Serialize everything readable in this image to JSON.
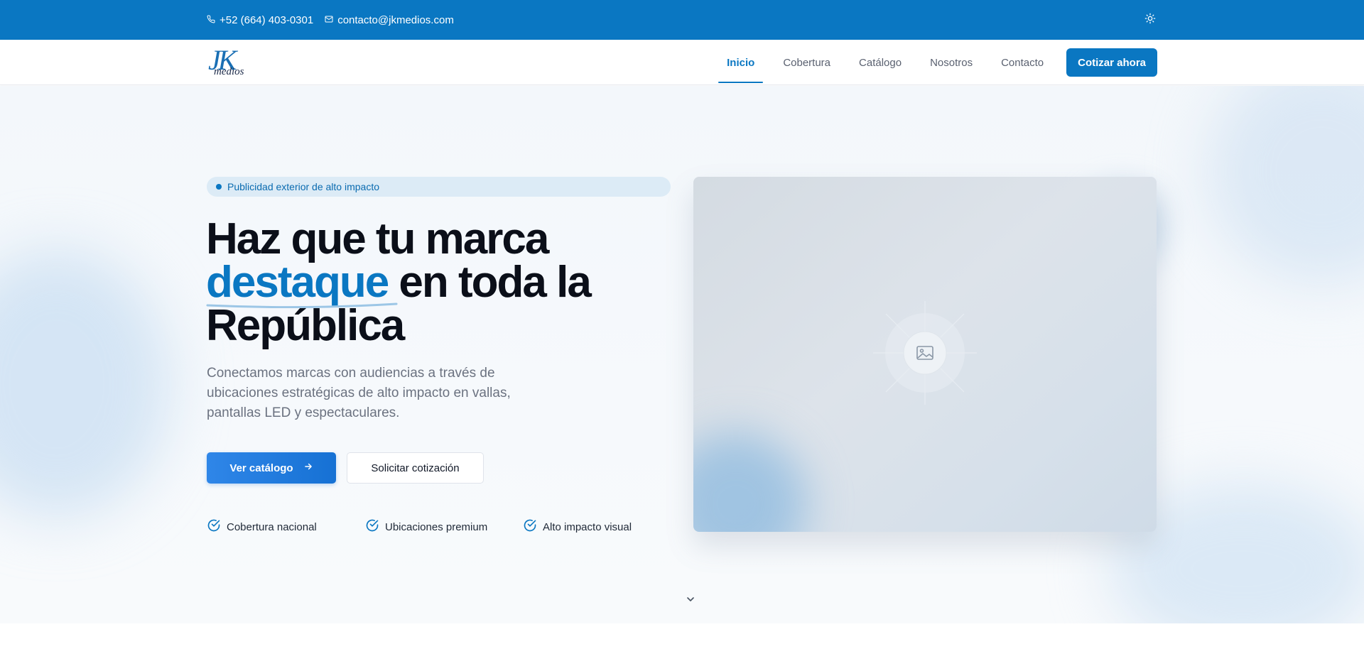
{
  "topbar": {
    "phone": "+52 (664) 403-0301",
    "email": "contacto@jkmedios.com",
    "theme_icon": "sun-icon"
  },
  "brand": {
    "logo_letters": "JK",
    "logo_sub": "medios"
  },
  "nav": {
    "items": [
      {
        "label": "Inicio",
        "active": true
      },
      {
        "label": "Cobertura",
        "active": false
      },
      {
        "label": "Catálogo",
        "active": false
      },
      {
        "label": "Nosotros",
        "active": false
      },
      {
        "label": "Contacto",
        "active": false
      }
    ],
    "cta": "Cotizar ahora"
  },
  "hero": {
    "badge": "Publicidad exterior de alto impacto",
    "headline_line1": "Haz que tu marca",
    "headline_accent": "destaque",
    "headline_line2_rest": " en toda la",
    "headline_line3": "República",
    "lead": "Conectamos marcas con audiencias a través de ubicaciones estratégicas de alto impacto en vallas, pantallas LED y espectaculares.",
    "primary_cta": "Ver catálogo",
    "secondary_cta": "Solicitar cotización",
    "features": [
      "Cobertura nacional",
      "Ubicaciones premium",
      "Alto impacto visual"
    ]
  },
  "colors": {
    "brand_blue": "#0a77c2",
    "heading": "#0b0f19",
    "muted": "#6b7280"
  }
}
